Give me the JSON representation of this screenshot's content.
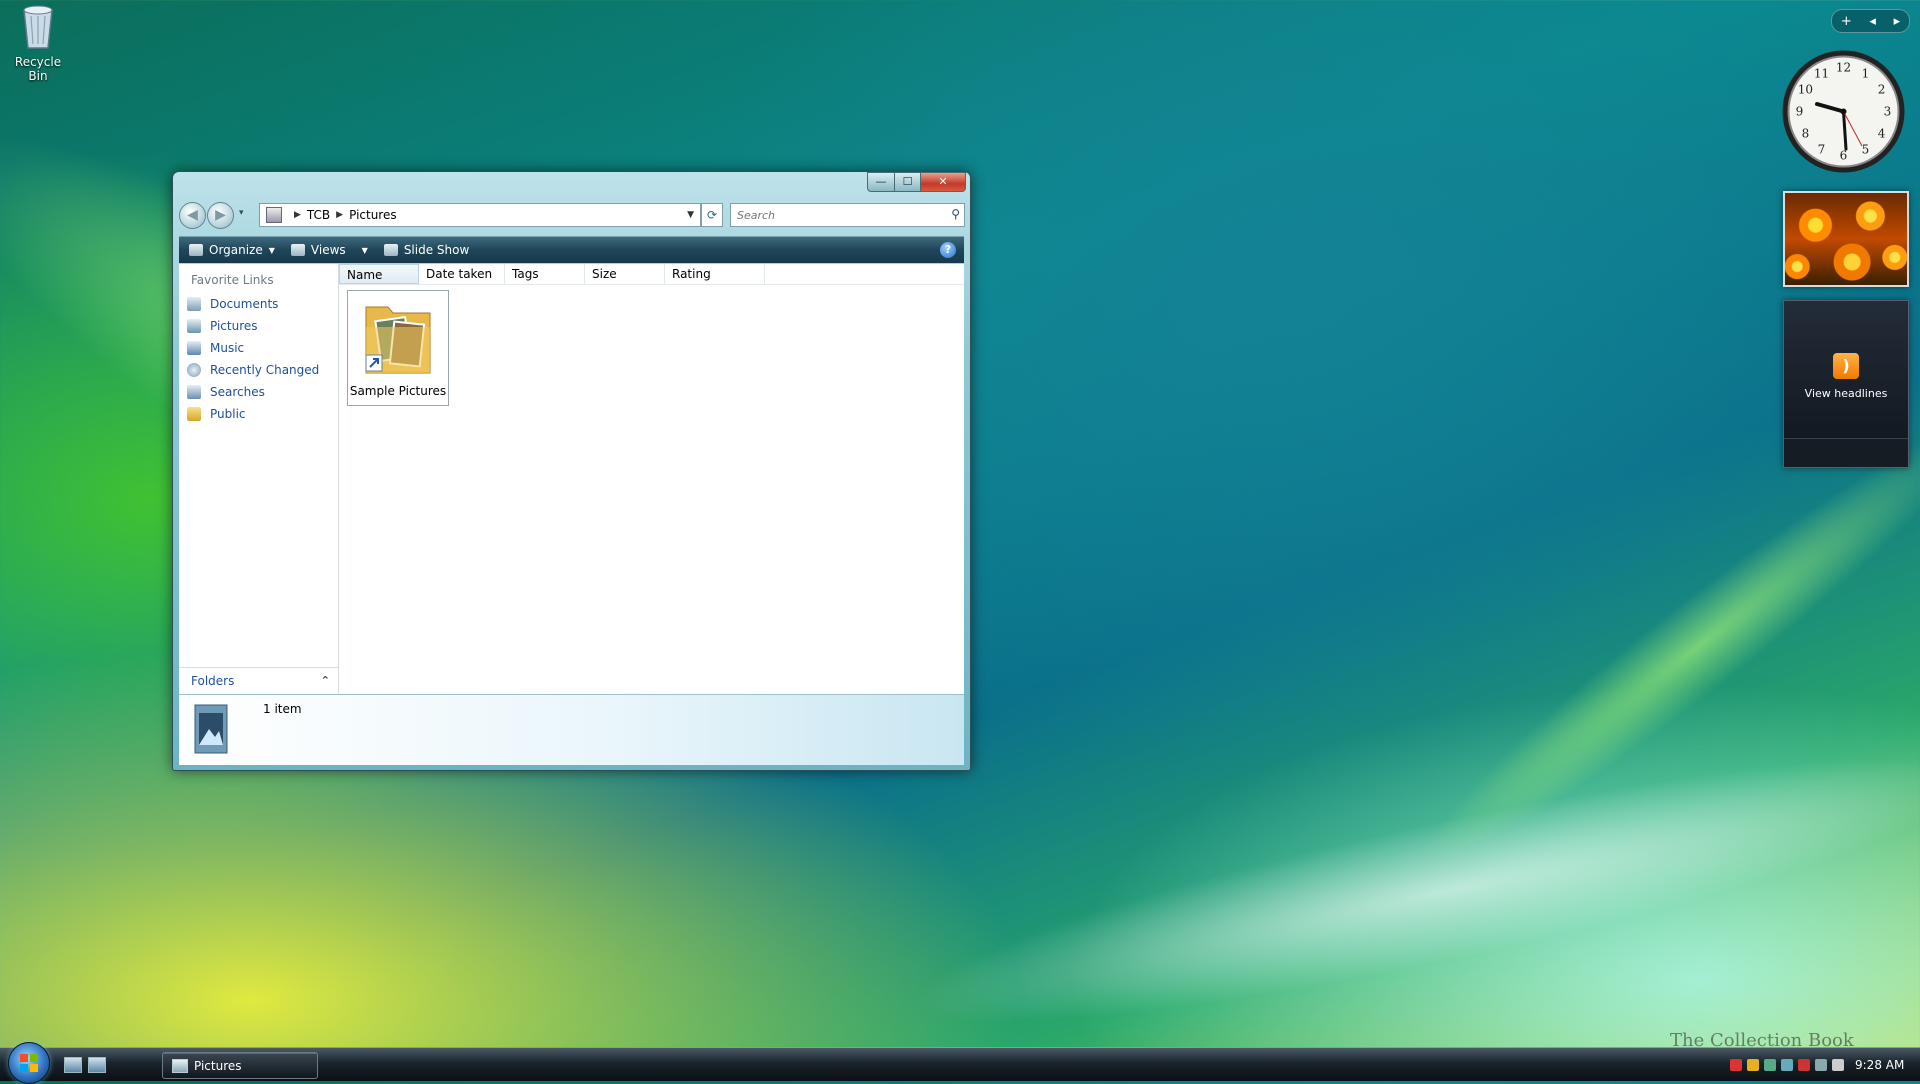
{
  "desktop": {
    "recycle_bin_label": "Recycle Bin"
  },
  "window": {
    "title": "Pictures",
    "controls": {
      "minimize": "—",
      "maximize": "☐",
      "close": "✕"
    },
    "address": {
      "crumbs": [
        "TCB",
        "Pictures"
      ],
      "search_placeholder": "Search"
    },
    "toolbar": {
      "organize": "Organize",
      "views": "Views",
      "slide_show": "Slide Show",
      "help": "?"
    },
    "nav_pane": {
      "title": "Favorite Links",
      "items": [
        "Documents",
        "Pictures",
        "Music",
        "Recently Changed",
        "Searches",
        "Public"
      ],
      "folders_label": "Folders"
    },
    "columns": [
      "Name",
      "Date taken",
      "Tags",
      "Size",
      "Rating"
    ],
    "items": [
      {
        "label": "Sample Pictures"
      }
    ],
    "details": {
      "count": "1 item"
    }
  },
  "sidebar": {
    "controls": {
      "add": "+",
      "prev": "◂",
      "next": "▸"
    },
    "feeds_label": "View headlines",
    "clock_numbers": [
      "12",
      "1",
      "2",
      "3",
      "4",
      "5",
      "6",
      "7",
      "8",
      "9",
      "10",
      "11"
    ]
  },
  "taskbar": {
    "task_label": "Pictures",
    "time": "9:28 AM"
  },
  "watermark": "The Collection Book",
  "colors": {
    "accent": "#1e4f9a",
    "toolbar_bg": "#1f4558",
    "close_button": "#c4392a"
  }
}
